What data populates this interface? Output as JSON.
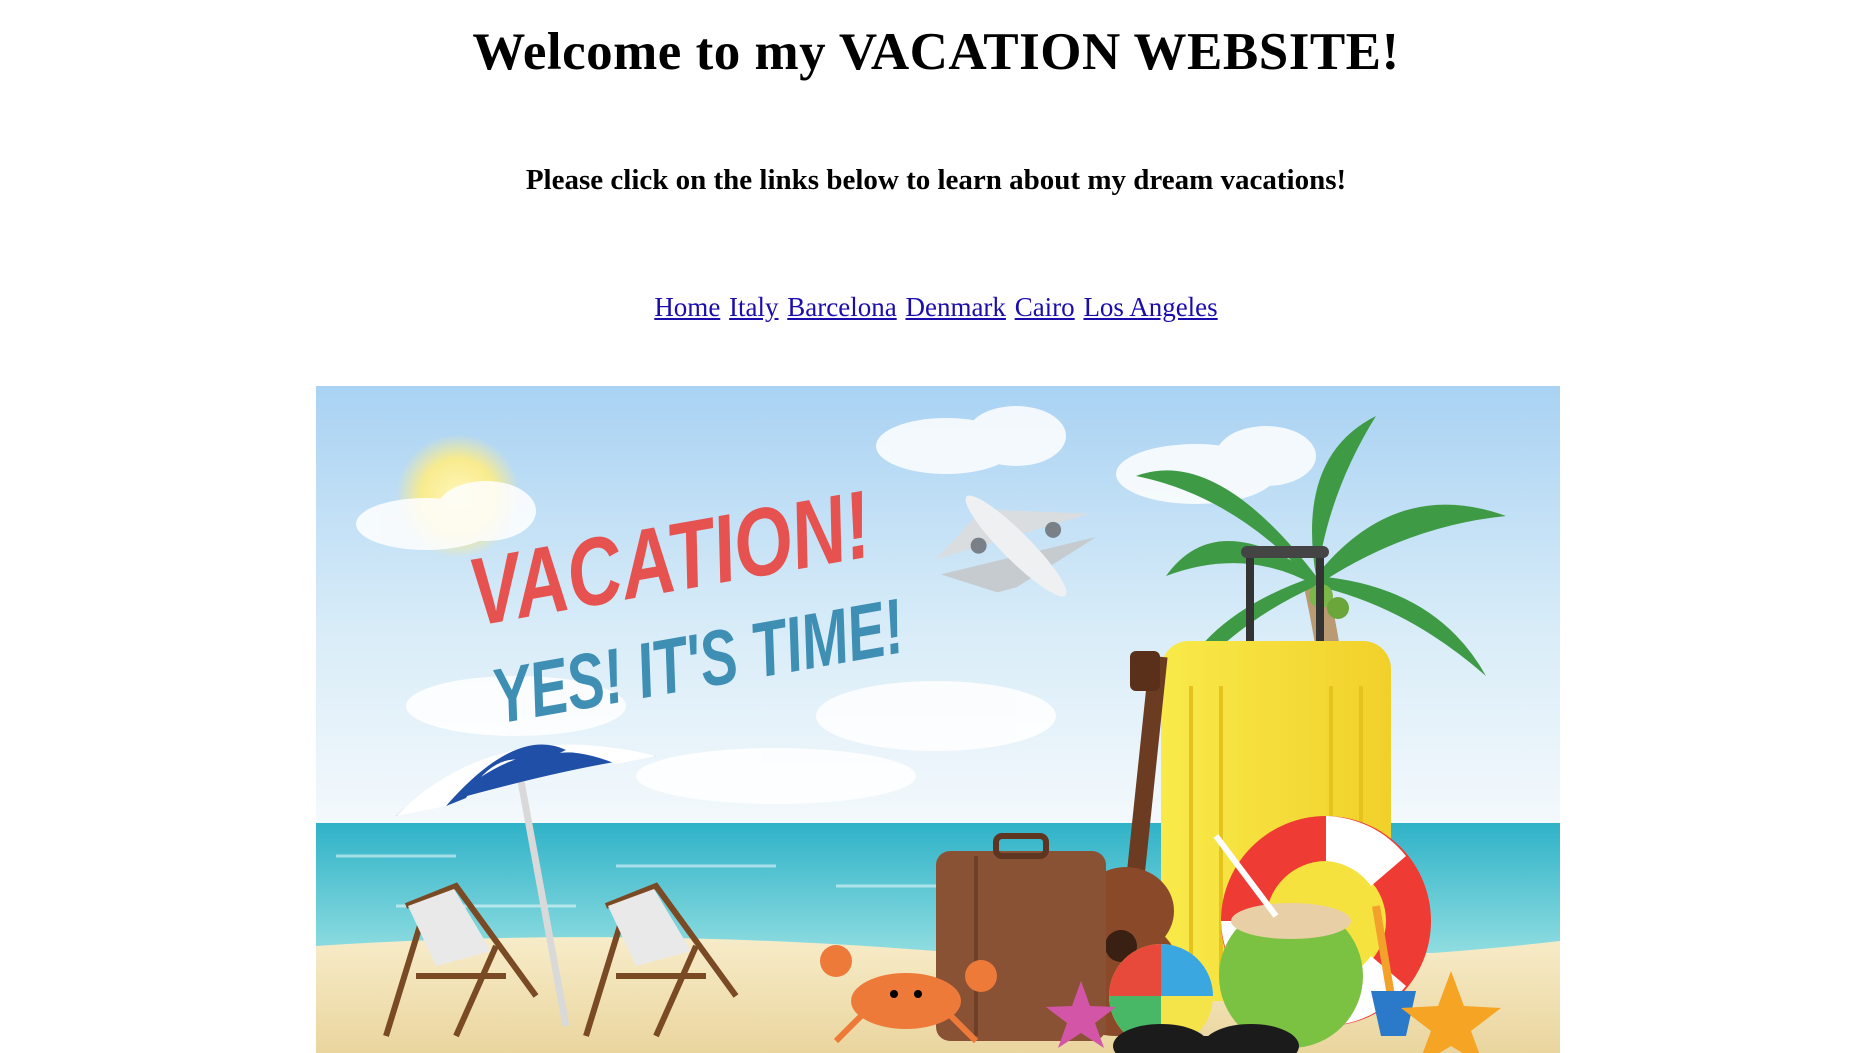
{
  "heading": "Welcome to my VACATION WEBSITE!",
  "subheading": "Please click on the links below to learn about my dream vacations!",
  "nav": {
    "links": [
      "Home",
      "Italy",
      "Barcelona",
      "Denmark",
      "Cairo",
      "Los Angeles"
    ]
  },
  "banner": {
    "headline": "VACATION!",
    "tagline": "YES! IT'S TIME!",
    "colors": {
      "headline": "#e5524f",
      "tagline": "#3f8fb5",
      "sky_top": "#a9d2f3",
      "sea": "#3cb8cc",
      "sand": "#f3e2b6",
      "suitcase": "#f6e23e"
    }
  }
}
